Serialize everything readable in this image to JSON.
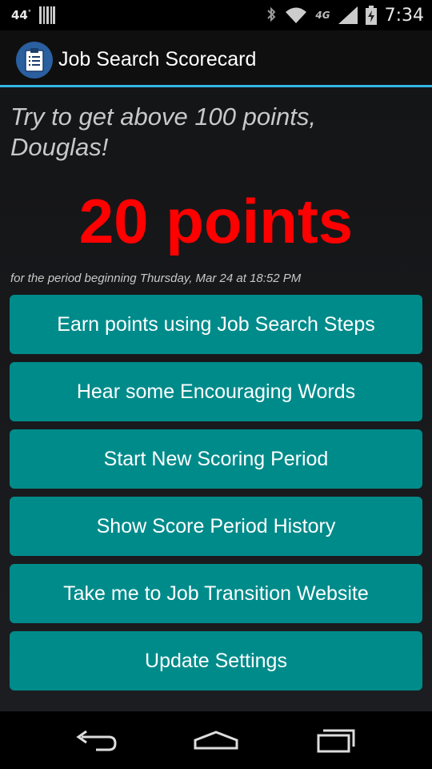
{
  "status_bar": {
    "temperature": "44",
    "temperature_unit": "°",
    "network": "4G",
    "time": "7:34"
  },
  "action_bar": {
    "title": "Job Search Scorecard",
    "icon": "clipboard-icon"
  },
  "main": {
    "prompt": "Try to get above 100 points, Douglas!",
    "score": "20 points",
    "period": "for the period beginning Thursday, Mar 24 at 18:52 PM",
    "buttons": [
      {
        "label": "Earn points using Job Search Steps"
      },
      {
        "label": "Hear some Encouraging Words"
      },
      {
        "label": "Start New Scoring Period"
      },
      {
        "label": "Show Score Period History"
      },
      {
        "label": "Take me to Job Transition Website"
      },
      {
        "label": "Update Settings"
      }
    ]
  },
  "nav_bar": {
    "icons": [
      "back-icon",
      "home-icon",
      "recent-apps-icon"
    ]
  },
  "colors": {
    "accent": "#33b5e5",
    "button": "#008b8b",
    "score": "#ff0000"
  }
}
